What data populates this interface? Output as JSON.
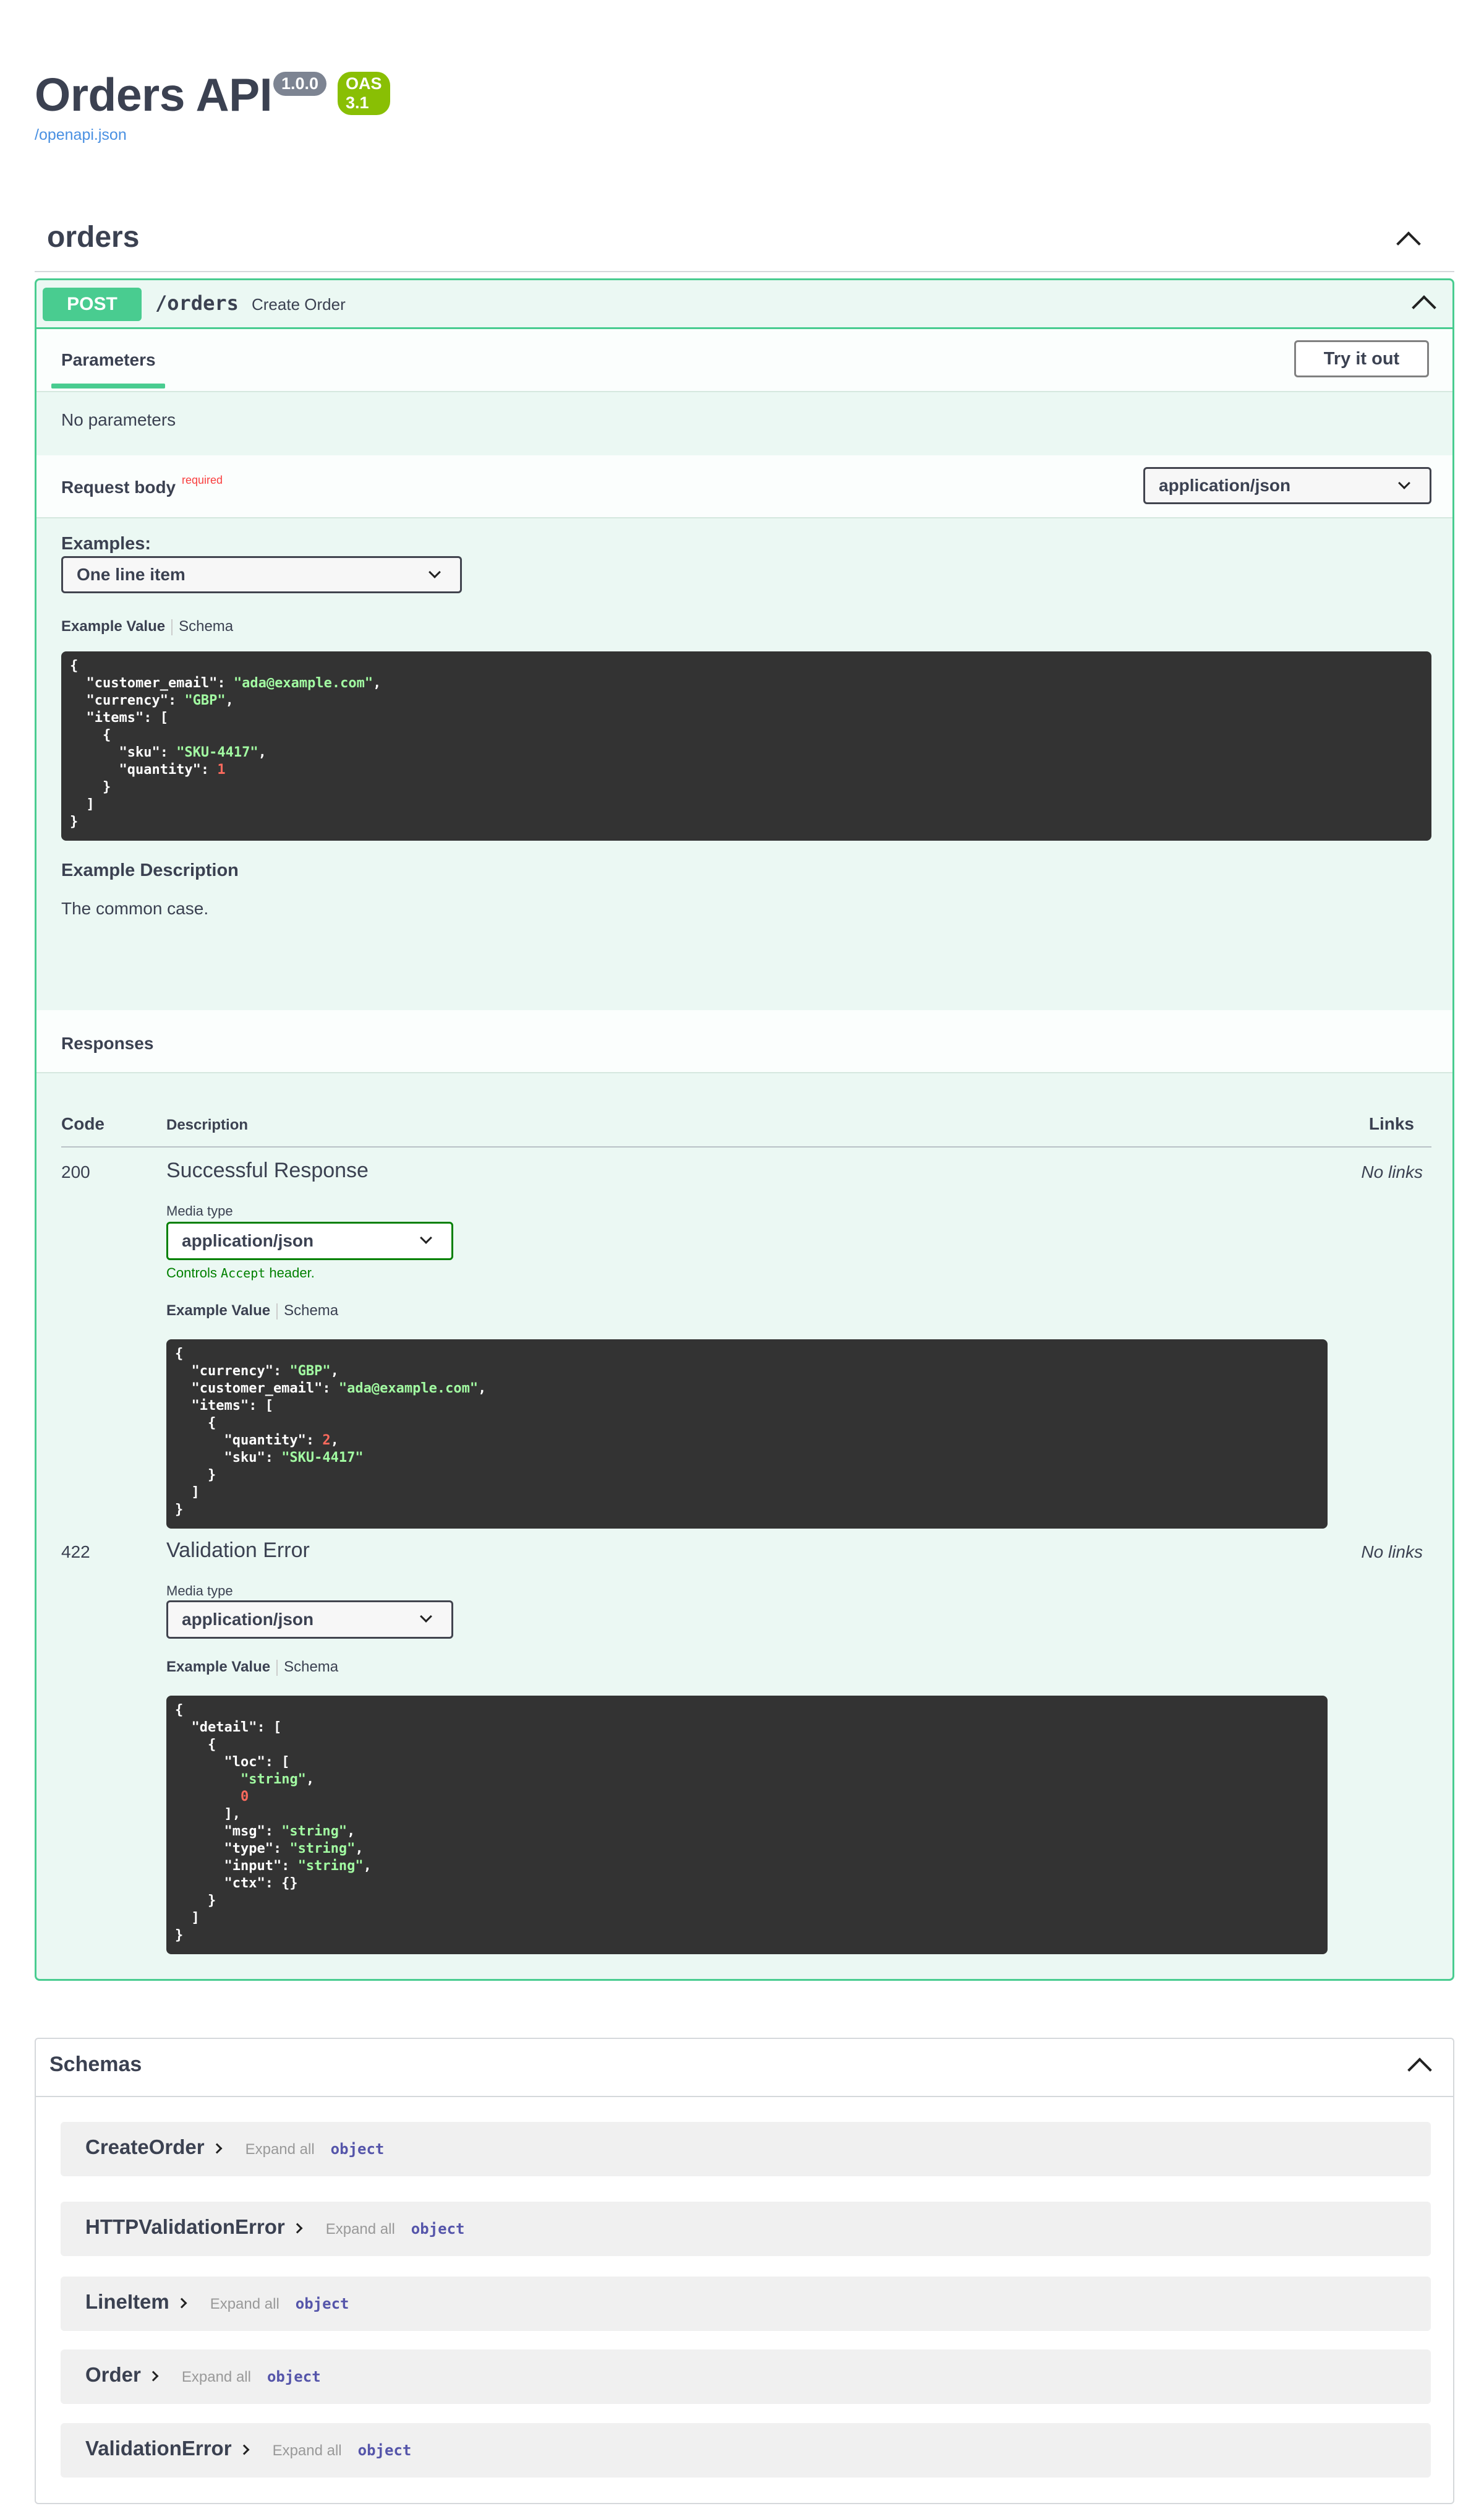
{
  "info": {
    "title": "Orders API",
    "version": "1.0.0",
    "oas": "OAS 3.1",
    "spec_url": "/openapi.json"
  },
  "tag": {
    "name": "orders"
  },
  "operation": {
    "method": "POST",
    "path": "/orders",
    "summary": "Create Order",
    "tab_parameters": "Parameters",
    "try_it_out": "Try it out",
    "no_parameters": "No parameters",
    "request_body_label": "Request body",
    "required_label": "required",
    "request_content_type": "application/json",
    "examples_label": "Examples:",
    "examples_selected": "One line item",
    "example_value_tab": "Example Value",
    "schema_tab": "Schema",
    "example_description_title": "Example Description",
    "example_description": "The common case.",
    "responses_label": "Responses",
    "responses_table": {
      "col_code": "Code",
      "col_description": "Description",
      "col_links": "Links"
    },
    "responses": [
      {
        "code": "200",
        "description": "Successful Response",
        "links": "No links",
        "media_type_label": "Media type",
        "media_type": "application/json",
        "controls_text_pre": "Controls ",
        "controls_code": "Accept",
        "controls_text_post": " header."
      },
      {
        "code": "422",
        "description": "Validation Error",
        "links": "No links",
        "media_type_label": "Media type",
        "media_type": "application/json"
      }
    ]
  },
  "schemas": {
    "title": "Schemas",
    "expand_all": "Expand all",
    "models": [
      {
        "name": "CreateOrder",
        "type": "object"
      },
      {
        "name": "HTTPValidationError",
        "type": "object"
      },
      {
        "name": "LineItem",
        "type": "object"
      },
      {
        "name": "Order",
        "type": "object"
      },
      {
        "name": "ValidationError",
        "type": "object"
      }
    ]
  },
  "code_samples": {
    "request_example": [
      {
        "t": "{"
      },
      {
        "t": "  \"customer_email\": ",
        "s": "\"ada@example.com\"",
        "e": ","
      },
      {
        "t": "  \"currency\": ",
        "s": "\"GBP\"",
        "e": ","
      },
      {
        "t": "  \"items\": ["
      },
      {
        "t": "    {"
      },
      {
        "t": "      \"sku\": ",
        "s": "\"SKU-4417\"",
        "e": ","
      },
      {
        "t": "      \"quantity\": ",
        "n": "1"
      },
      {
        "t": "    }"
      },
      {
        "t": "  ]"
      },
      {
        "t": "}"
      }
    ],
    "response_200_example": [
      {
        "t": "{"
      },
      {
        "t": "  \"currency\": ",
        "s": "\"GBP\"",
        "e": ","
      },
      {
        "t": "  \"customer_email\": ",
        "s": "\"ada@example.com\"",
        "e": ","
      },
      {
        "t": "  \"items\": ["
      },
      {
        "t": "    {"
      },
      {
        "t": "      \"quantity\": ",
        "n": "2",
        "e": ","
      },
      {
        "t": "      \"sku\": ",
        "s": "\"SKU-4417\""
      },
      {
        "t": "    }"
      },
      {
        "t": "  ]"
      },
      {
        "t": "}"
      }
    ],
    "response_422_example": [
      {
        "t": "{"
      },
      {
        "t": "  \"detail\": ["
      },
      {
        "t": "    {"
      },
      {
        "t": "      \"loc\": ["
      },
      {
        "t": "        ",
        "s": "\"string\"",
        "e": ","
      },
      {
        "t": "        ",
        "n": "0"
      },
      {
        "t": "      ],"
      },
      {
        "t": "      \"msg\": ",
        "s": "\"string\"",
        "e": ","
      },
      {
        "t": "      \"type\": ",
        "s": "\"string\"",
        "e": ","
      },
      {
        "t": "      \"input\": ",
        "s": "\"string\"",
        "e": ","
      },
      {
        "t": "      \"ctx\": {}"
      },
      {
        "t": "    }"
      },
      {
        "t": "  ]"
      },
      {
        "t": "}"
      }
    ]
  },
  "colors": {
    "post_method": "#49cc90",
    "post_background": "#ebf8f3",
    "code_background": "#333333",
    "code_string": "#a2fca2",
    "code_number": "#fc6a5d",
    "required": "#f93e3e",
    "link": "#4990e2",
    "controls_text": "#008000"
  }
}
